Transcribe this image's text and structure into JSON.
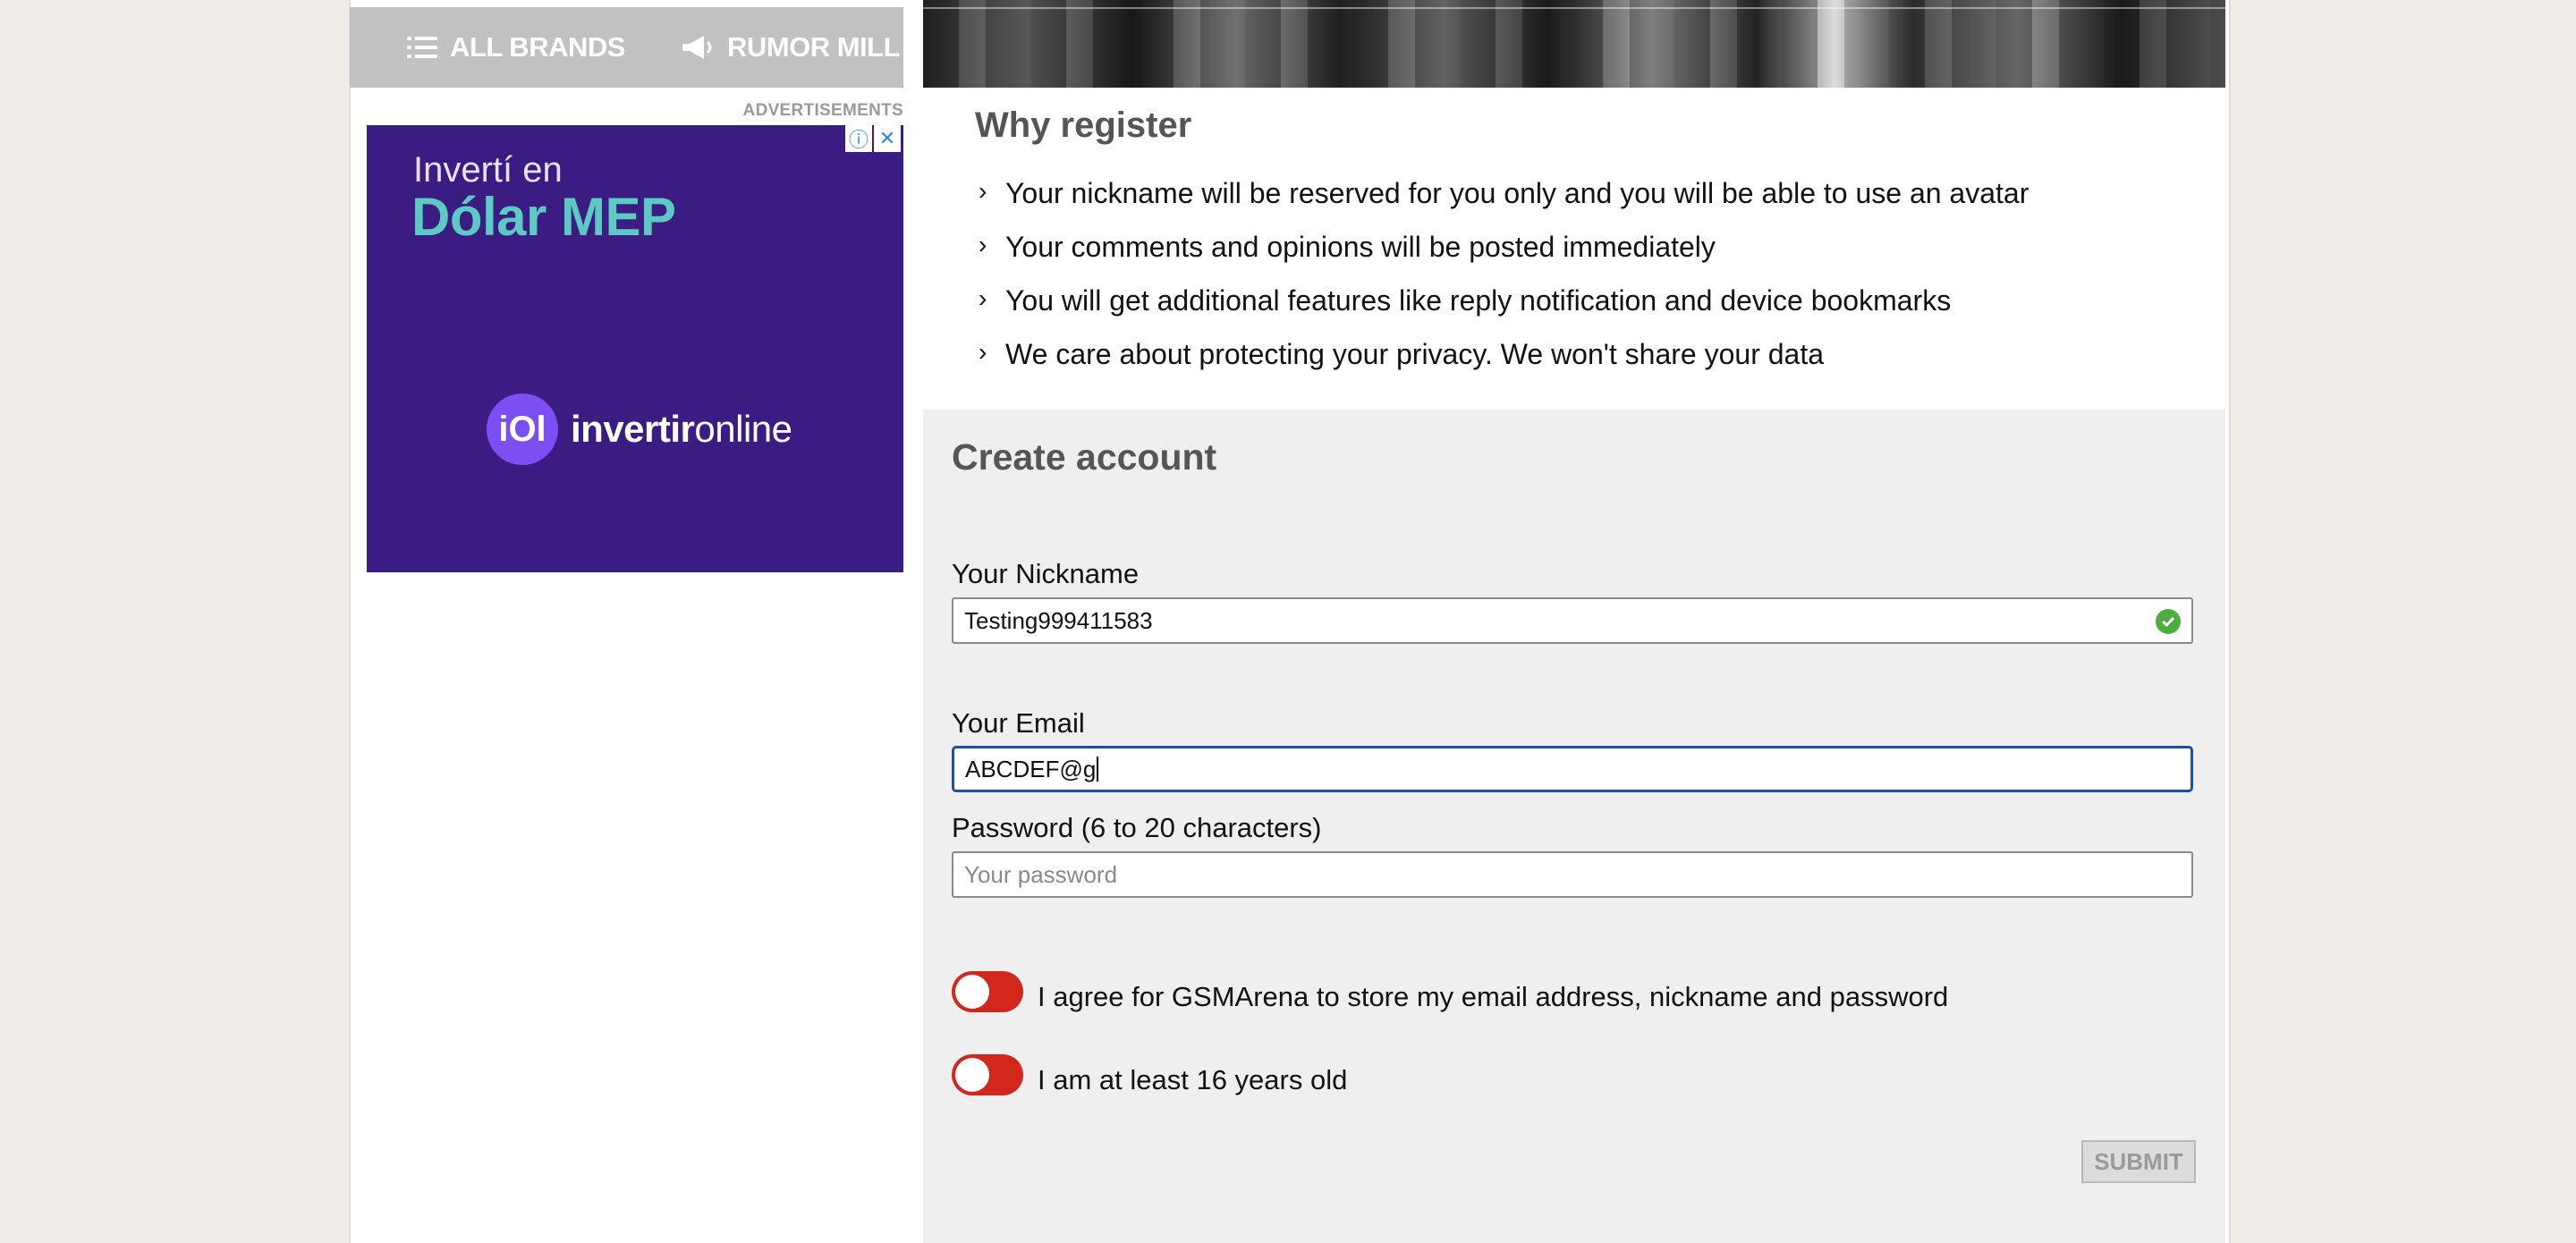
{
  "nav": {
    "all_brands": "ALL BRANDS",
    "rumor_mill": "RUMOR MILL",
    "icons": [
      "list-icon",
      "megaphone-icon"
    ]
  },
  "ad": {
    "label": "ADVERTISEMENTS",
    "line1": "Invertí en",
    "line2": "Dólar MEP",
    "logo_mark": "iOl",
    "logo_text_bold": "invertir",
    "logo_text": "online",
    "info_icon": "ⓘ",
    "close_icon": "✕"
  },
  "why": {
    "title": "Why register",
    "items": [
      "Your nickname will be reserved for you only and you will be able to use an avatar",
      "Your comments and opinions will be posted immediately",
      "You will get additional features like reply notification and device bookmarks",
      "We care about protecting your privacy. We won't share your data"
    ]
  },
  "form": {
    "title": "Create account",
    "nickname_label": "Your Nickname",
    "nickname_value": "Testing999411583",
    "email_label": "Your Email",
    "email_value": "ABCDEF@g",
    "password_label": "Password (6 to 20 characters)",
    "password_placeholder": "Your password",
    "agree_label": "I agree for GSMArena to store my email address, nickname and password",
    "age_label": "I am at least 16 years old",
    "submit_label": "SUBMIT"
  },
  "colors": {
    "toggle_off": "#d3261c",
    "valid_check": "#4caf3d",
    "focus_border": "#1d4fae",
    "ad_background": "#3a1c82"
  }
}
